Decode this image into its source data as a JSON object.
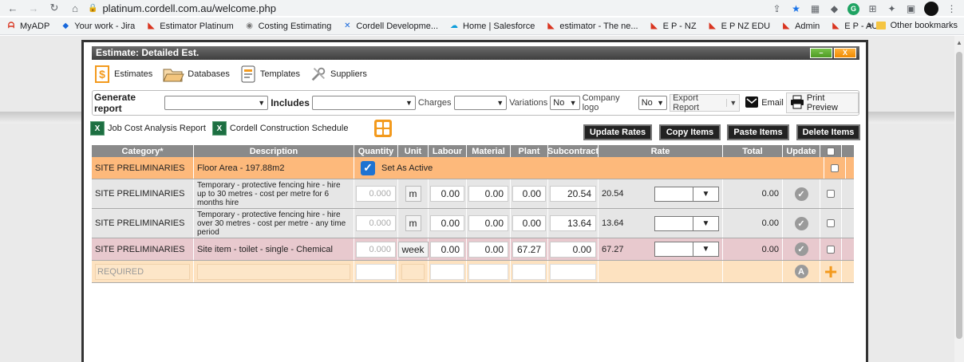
{
  "browser": {
    "url": "platinum.cordell.com.au/welcome.php",
    "bookmarks": [
      {
        "label": "MyADP",
        "icon": "adp-icon"
      },
      {
        "label": "Your work - Jira",
        "icon": "jira-icon"
      },
      {
        "label": "Estimator Platinum",
        "icon": "cordell-icon"
      },
      {
        "label": "Costing Estimating",
        "icon": "gray-icon"
      },
      {
        "label": "Cordell Developme...",
        "icon": "confluence-icon"
      },
      {
        "label": "Home | Salesforce",
        "icon": "salesforce-icon"
      },
      {
        "label": "estimator - The ne...",
        "icon": "cordell-icon"
      },
      {
        "label": "E P -  NZ",
        "icon": "cordell-icon"
      },
      {
        "label": "E P NZ EDU",
        "icon": "cordell-icon"
      },
      {
        "label": "Admin",
        "icon": "cordell-icon"
      },
      {
        "label": "E P - AU",
        "icon": "cordell-icon"
      }
    ],
    "more": "»",
    "other_bookmarks": "Other bookmarks"
  },
  "window": {
    "title": "Estimate: Detailed Est.",
    "min_label": "–",
    "close_label": "X"
  },
  "toolbar": {
    "estimates": "Estimates",
    "databases": "Databases",
    "templates": "Templates",
    "suppliers": "Suppliers"
  },
  "report": {
    "generate_label": "Generate report",
    "generate_value": "",
    "includes_label": "Includes",
    "includes_value": "",
    "charges_label": "Charges",
    "charges_value": "",
    "variations_label": "Variations",
    "variations_value": "No",
    "logo_label": "Company logo",
    "logo_value": "No",
    "export_label": "Export Report",
    "email_label": "Email",
    "print_label": "Print Preview"
  },
  "links": {
    "job_cost": "Job Cost Analysis Report",
    "schedule": "Cordell Construction Schedule"
  },
  "actions": {
    "update_rates": "Update Rates",
    "copy_items": "Copy Items",
    "paste_items": "Paste Items",
    "delete_items": "Delete Items"
  },
  "grid": {
    "headers": {
      "category": "Category*",
      "description": "Description",
      "quantity": "Quantity",
      "unit": "Unit",
      "labour": "Labour",
      "material": "Material",
      "plant": "Plant",
      "subcontract": "Subcontract",
      "rate": "Rate",
      "total": "Total",
      "update": "Update"
    },
    "floor_row": {
      "category": "SITE PRELIMINARIES",
      "description": "Floor Area - 197.88m2",
      "active_label": "Set As Active"
    },
    "rows": [
      {
        "category": "SITE PRELIMINARIES",
        "description": "Temporary - protective fencing hire - hire up to 30 metres - cost per metre for 6 months hire",
        "quantity": "0.000",
        "unit": "m",
        "labour": "0.00",
        "material": "0.00",
        "plant": "0.00",
        "subcontract": "20.54",
        "rate": "20.54",
        "total": "0.00"
      },
      {
        "category": "SITE PRELIMINARIES",
        "description": "Temporary - protective fencing hire - hire over 30 metres - cost per metre - any time period",
        "quantity": "0.000",
        "unit": "m",
        "labour": "0.00",
        "material": "0.00",
        "plant": "0.00",
        "subcontract": "13.64",
        "rate": "13.64",
        "total": "0.00"
      },
      {
        "category": "SITE PRELIMINARIES",
        "description": "Site item - toilet - single - Chemical",
        "quantity": "0.000",
        "unit": "week",
        "labour": "0.00",
        "material": "0.00",
        "plant": "67.27",
        "subcontract": "0.00",
        "rate": "67.27",
        "total": "0.00"
      }
    ],
    "required_row": {
      "category": "REQUIRED",
      "auto_label": "A",
      "add_label": "+"
    }
  },
  "colors": {
    "header_gray": "#8a8a8a",
    "floor_orange": "#fdb97b",
    "item_pink": "#e8c9ce",
    "required_peach": "#fde2c0",
    "accent_orange": "#f39a1d"
  }
}
